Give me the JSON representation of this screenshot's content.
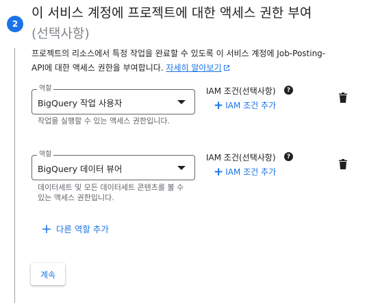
{
  "step": {
    "number": "2"
  },
  "heading": {
    "title": "이 서비스 계정에 프로젝트에 대한 액세스 권한 부여",
    "optional": "(선택사항)"
  },
  "description": {
    "text": "프로젝트의 리소스에서 특정 작업을 완료할 수 있도록 이 서비스 계정에 Job-Posting-API에 대한 액세스 권한을 부여합니다.",
    "link": "자세히 알아보기"
  },
  "roles": [
    {
      "field_label": "역할",
      "value": "BigQuery 작업 사용자",
      "hint": "작업을 실행할 수 있는 액세스 권한입니다.",
      "iam_label": "IAM 조건(선택사항)",
      "add_iam": "IAM 조건 추가"
    },
    {
      "field_label": "역할",
      "value": "BigQuery 데이터 뷰어",
      "hint": "데이터세트 및 모든 데이터세트 콘텐츠를 볼 수 있는 액세스 권한입니다.",
      "iam_label": "IAM 조건(선택사항)",
      "add_iam": "IAM 조건 추가"
    }
  ],
  "add_role": {
    "label": "다른 역할 추가"
  },
  "continue_button": {
    "label": "계속"
  },
  "colors": {
    "accent": "#1a73e8",
    "text": "#202124",
    "secondary": "#5f6368"
  }
}
